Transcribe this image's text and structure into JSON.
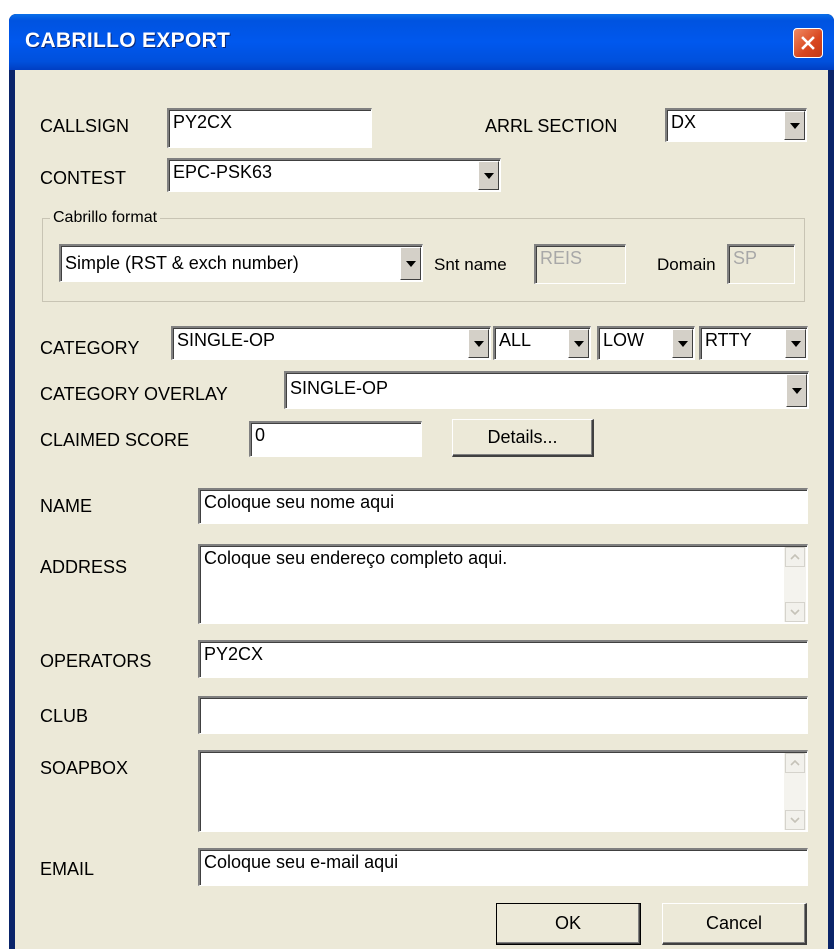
{
  "window": {
    "title": "CABRILLO EXPORT"
  },
  "callsign": {
    "label": "CALLSIGN",
    "value": "PY2CX"
  },
  "arrl_section": {
    "label": "ARRL SECTION",
    "value": "DX"
  },
  "contest": {
    "label": "CONTEST",
    "value": "EPC-PSK63"
  },
  "cabrillo_format": {
    "group_label": "Cabrillo format",
    "format_value": "Simple (RST & exch number)",
    "snt_name_label": "Snt name",
    "snt_name_value": "REIS",
    "domain_label": "Domain",
    "domain_value": "SP"
  },
  "category": {
    "label": "CATEGORY",
    "operator": "SINGLE-OP",
    "band": "ALL",
    "power": "LOW",
    "mode": "RTTY"
  },
  "category_overlay": {
    "label": "CATEGORY OVERLAY",
    "value": "SINGLE-OP"
  },
  "claimed_score": {
    "label": "CLAIMED SCORE",
    "value": "0",
    "details_button": "Details..."
  },
  "name": {
    "label": "NAME",
    "value": "Coloque seu nome aqui"
  },
  "address": {
    "label": "ADDRESS",
    "value": "Coloque seu endereço completo aqui."
  },
  "operators": {
    "label": "OPERATORS",
    "value": "PY2CX"
  },
  "club": {
    "label": "CLUB",
    "value": ""
  },
  "soapbox": {
    "label": "SOAPBOX",
    "value": ""
  },
  "email": {
    "label": "EMAIL",
    "value": "Coloque seu e-mail aqui"
  },
  "buttons": {
    "ok": "OK",
    "cancel": "Cancel"
  },
  "colors": {
    "titlebar": "#0058ee",
    "dialog_bg": "#ece9d8",
    "close_button": "#d8461f"
  }
}
